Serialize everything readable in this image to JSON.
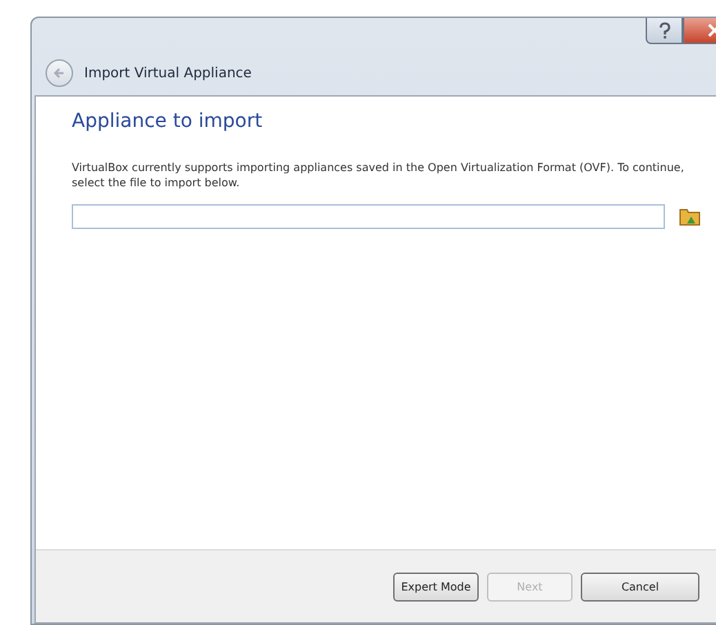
{
  "window": {
    "title": "Import Virtual Appliance"
  },
  "page": {
    "heading": "Appliance to import",
    "description": "VirtualBox currently supports importing appliances saved in the Open Virtualization Format (OVF). To continue, select the file to import below."
  },
  "buttons": [
    {
      "label": "Expert Mode",
      "disabled": false
    },
    {
      "label": "Next",
      "disabled": true
    },
    {
      "label": "Cancel",
      "disabled": false
    }
  ]
}
